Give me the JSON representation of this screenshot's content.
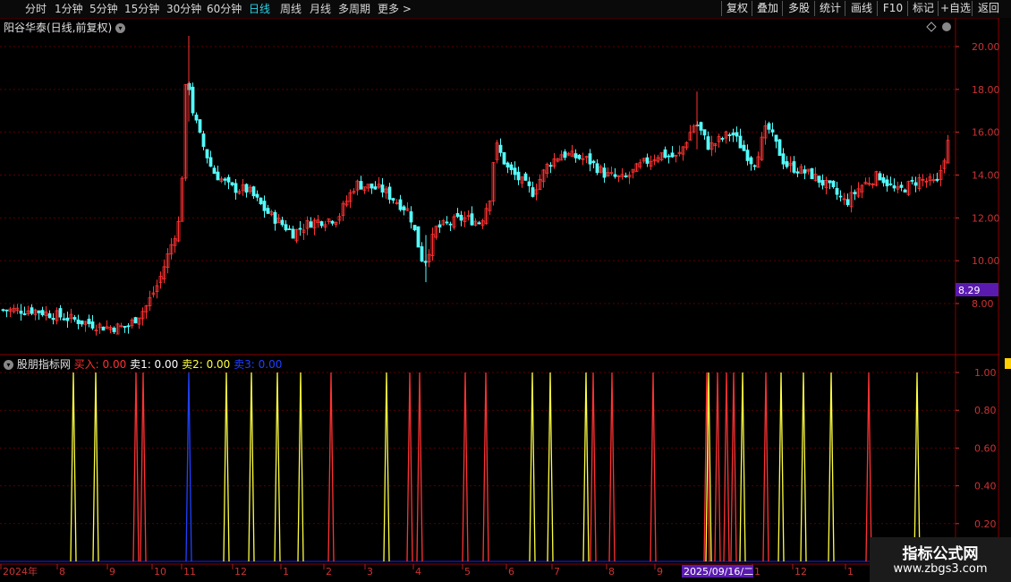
{
  "toolbar": {
    "periods": [
      "分时",
      "1分钟",
      "5分钟",
      "15分钟",
      "30分钟",
      "60分钟",
      "日线",
      "周线",
      "月线",
      "多周期",
      "更多 >"
    ],
    "active_period": "日线",
    "right_buttons": [
      "复权",
      "叠加",
      "多股",
      "统计",
      "画线",
      "F10",
      "标记",
      "+自选",
      "返回"
    ]
  },
  "main_chart": {
    "title": "阳谷华泰(日线,前复权)",
    "price_ticks": [
      "20.00",
      "18.00",
      "16.00",
      "14.00",
      "12.00",
      "10.00",
      "8.00"
    ],
    "current_label": "8.29"
  },
  "indicator": {
    "name": "股朋指标网",
    "items": [
      {
        "label": "买入: 0.00",
        "color": "#ff3030"
      },
      {
        "label": "卖1: 0.00",
        "color": "#ffffff"
      },
      {
        "label": "卖2: 0.00",
        "color": "#ffff40"
      },
      {
        "label": "卖3: 0.00",
        "color": "#2040ff"
      }
    ],
    "y_ticks": [
      "1.00",
      "0.80",
      "0.60",
      "0.40",
      "0.20"
    ]
  },
  "date_axis": {
    "labels": [
      "2024年",
      "8",
      "9",
      "10",
      "11",
      "12",
      "1",
      "2",
      "3",
      "4",
      "5",
      "6",
      "7",
      "8",
      "9",
      "1",
      "12",
      "1"
    ],
    "highlight": "2025/09/16/二"
  },
  "watermark": {
    "line1": "指标公式网",
    "line2": "www.zbgs3.com"
  },
  "colors": {
    "up": "#ff3232",
    "down": "#54fcfc",
    "sell2": "#ffff40",
    "sell3": "#2040ff",
    "grid": "#5a0000"
  }
}
